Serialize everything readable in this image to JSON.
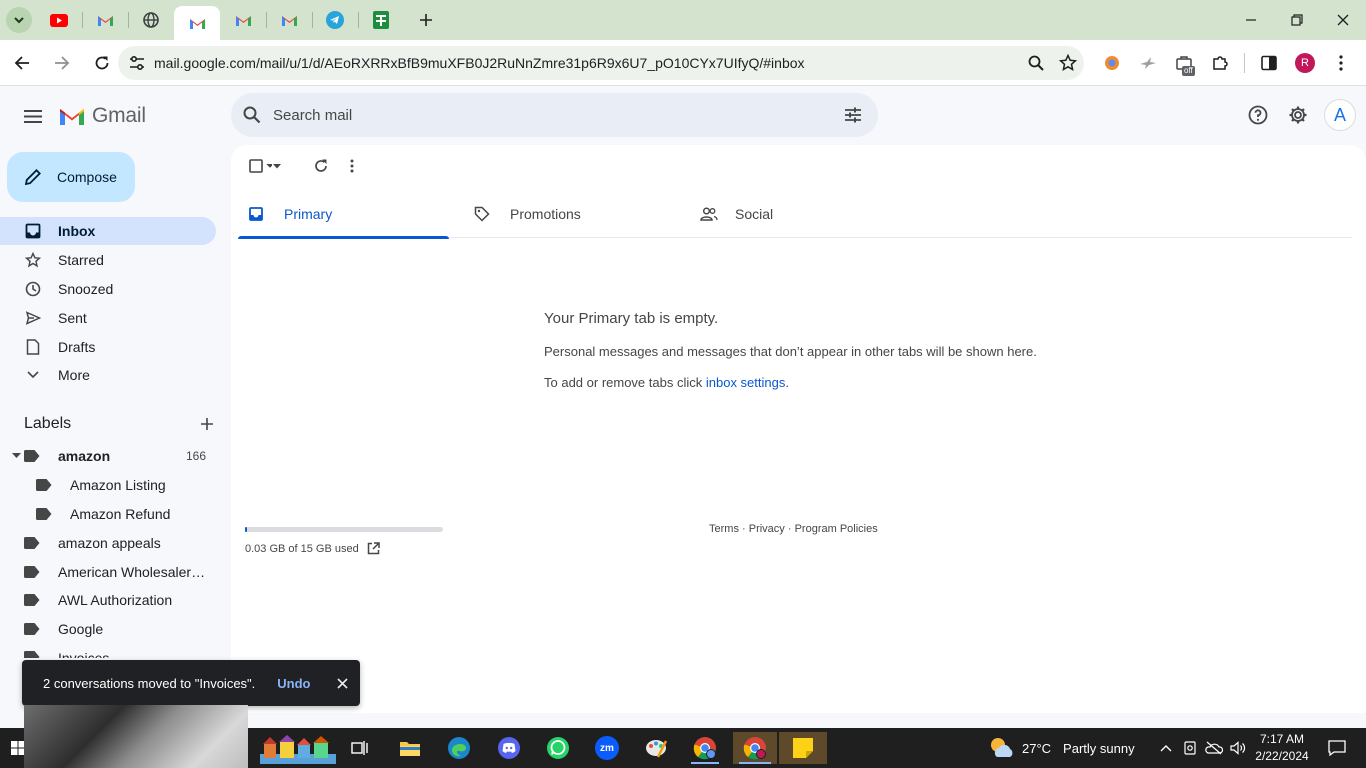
{
  "browser": {
    "url": "mail.google.com/mail/u/1/d/AEoRXRRxBfB9muXFB0J2RuNnZmre31p6R9x6U7_pO10CYx7UIfyQ/#inbox",
    "profile_initial": "R",
    "ext_badge": "off"
  },
  "gmail": {
    "logo_text": "Gmail",
    "search_placeholder": "Search mail",
    "account_initial": "A",
    "compose_label": "Compose"
  },
  "sidebar": {
    "items": [
      {
        "label": "Inbox",
        "icon": "inbox-icon",
        "active": true
      },
      {
        "label": "Starred",
        "icon": "star-icon"
      },
      {
        "label": "Snoozed",
        "icon": "clock-icon"
      },
      {
        "label": "Sent",
        "icon": "send-icon"
      },
      {
        "label": "Drafts",
        "icon": "draft-icon"
      },
      {
        "label": "More",
        "icon": "chevron-down-icon"
      }
    ],
    "labels_title": "Labels",
    "labels": [
      {
        "name": "amazon",
        "count": "166",
        "level": 0,
        "bold": true,
        "expanded": true
      },
      {
        "name": "Amazon Listing",
        "level": 1
      },
      {
        "name": "Amazon Refund",
        "level": 1
      },
      {
        "name": "amazon appeals",
        "level": 0
      },
      {
        "name": "American Wholesalers L...",
        "level": 0
      },
      {
        "name": "AWL Authorization",
        "level": 0
      },
      {
        "name": "Google",
        "level": 0
      },
      {
        "name": "Invoices",
        "level": 0
      }
    ]
  },
  "tabs": [
    {
      "label": "Primary",
      "icon": "inbox-tab-icon",
      "active": true
    },
    {
      "label": "Promotions",
      "icon": "tag-icon"
    },
    {
      "label": "Social",
      "icon": "people-icon"
    }
  ],
  "empty_state": {
    "title": "Your Primary tab is empty.",
    "text": "Personal messages and messages that don’t appear in other tabs will be shown here.",
    "text2_prefix": "To add or remove tabs click ",
    "text2_link": "inbox settings",
    "text2_suffix": "."
  },
  "storage": {
    "used_text": "0.03 GB of 15 GB used",
    "fraction": 0.002
  },
  "footer": {
    "terms": "Terms",
    "sep": " · ",
    "privacy": "Privacy",
    "policies": "Program Policies"
  },
  "toast": {
    "message": "2 conversations moved to \"Invoices\".",
    "undo": "Undo"
  },
  "taskbar": {
    "temperature": "27°C",
    "weather": "Partly sunny",
    "time": "7:17 AM",
    "date": "2/22/2024",
    "zoom_label": "zm"
  },
  "colors": {
    "accent": "#0b57d0",
    "compose_bg": "#c2e7ff",
    "active_nav": "#d3e3fd",
    "tabstrip": "#d3e3cd"
  }
}
